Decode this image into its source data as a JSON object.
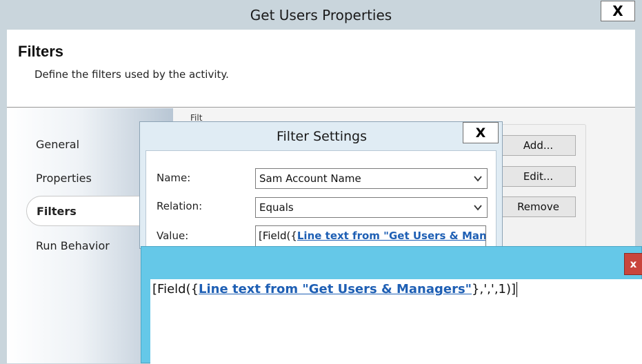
{
  "main_window": {
    "title": "Get Users Properties",
    "close_label": "X"
  },
  "header": {
    "title": "Filters",
    "subtitle": "Define the filters used by the activity."
  },
  "sidebar": {
    "items": [
      {
        "label": "General"
      },
      {
        "label": "Properties"
      },
      {
        "label": "Filters",
        "active": true
      },
      {
        "label": "Run Behavior"
      }
    ]
  },
  "filters_panel": {
    "group_label_peek": "Filt",
    "buttons": {
      "add": "Add...",
      "edit": "Edit...",
      "remove": "Remove"
    }
  },
  "filter_settings": {
    "title": "Filter Settings",
    "close_label": "X",
    "name_label": "Name:",
    "name_value": "Sam Account Name",
    "relation_label": "Relation:",
    "relation_value": "Equals",
    "value_label": "Value:",
    "value_prefix": "[Field({",
    "value_link": "Line text from \"Get Users & Man"
  },
  "expression_editor": {
    "close_label": "x",
    "prefix": "[Field({",
    "link": "Line text from \"Get Users & Managers\"",
    "suffix": "},',',1)]"
  },
  "colors": {
    "title_bar": "#c9d5dc",
    "dialog_bg": "#e0ecf4",
    "expression_bg": "#65c8e8",
    "link": "#1e5fb4",
    "close_red": "#c9453c"
  }
}
